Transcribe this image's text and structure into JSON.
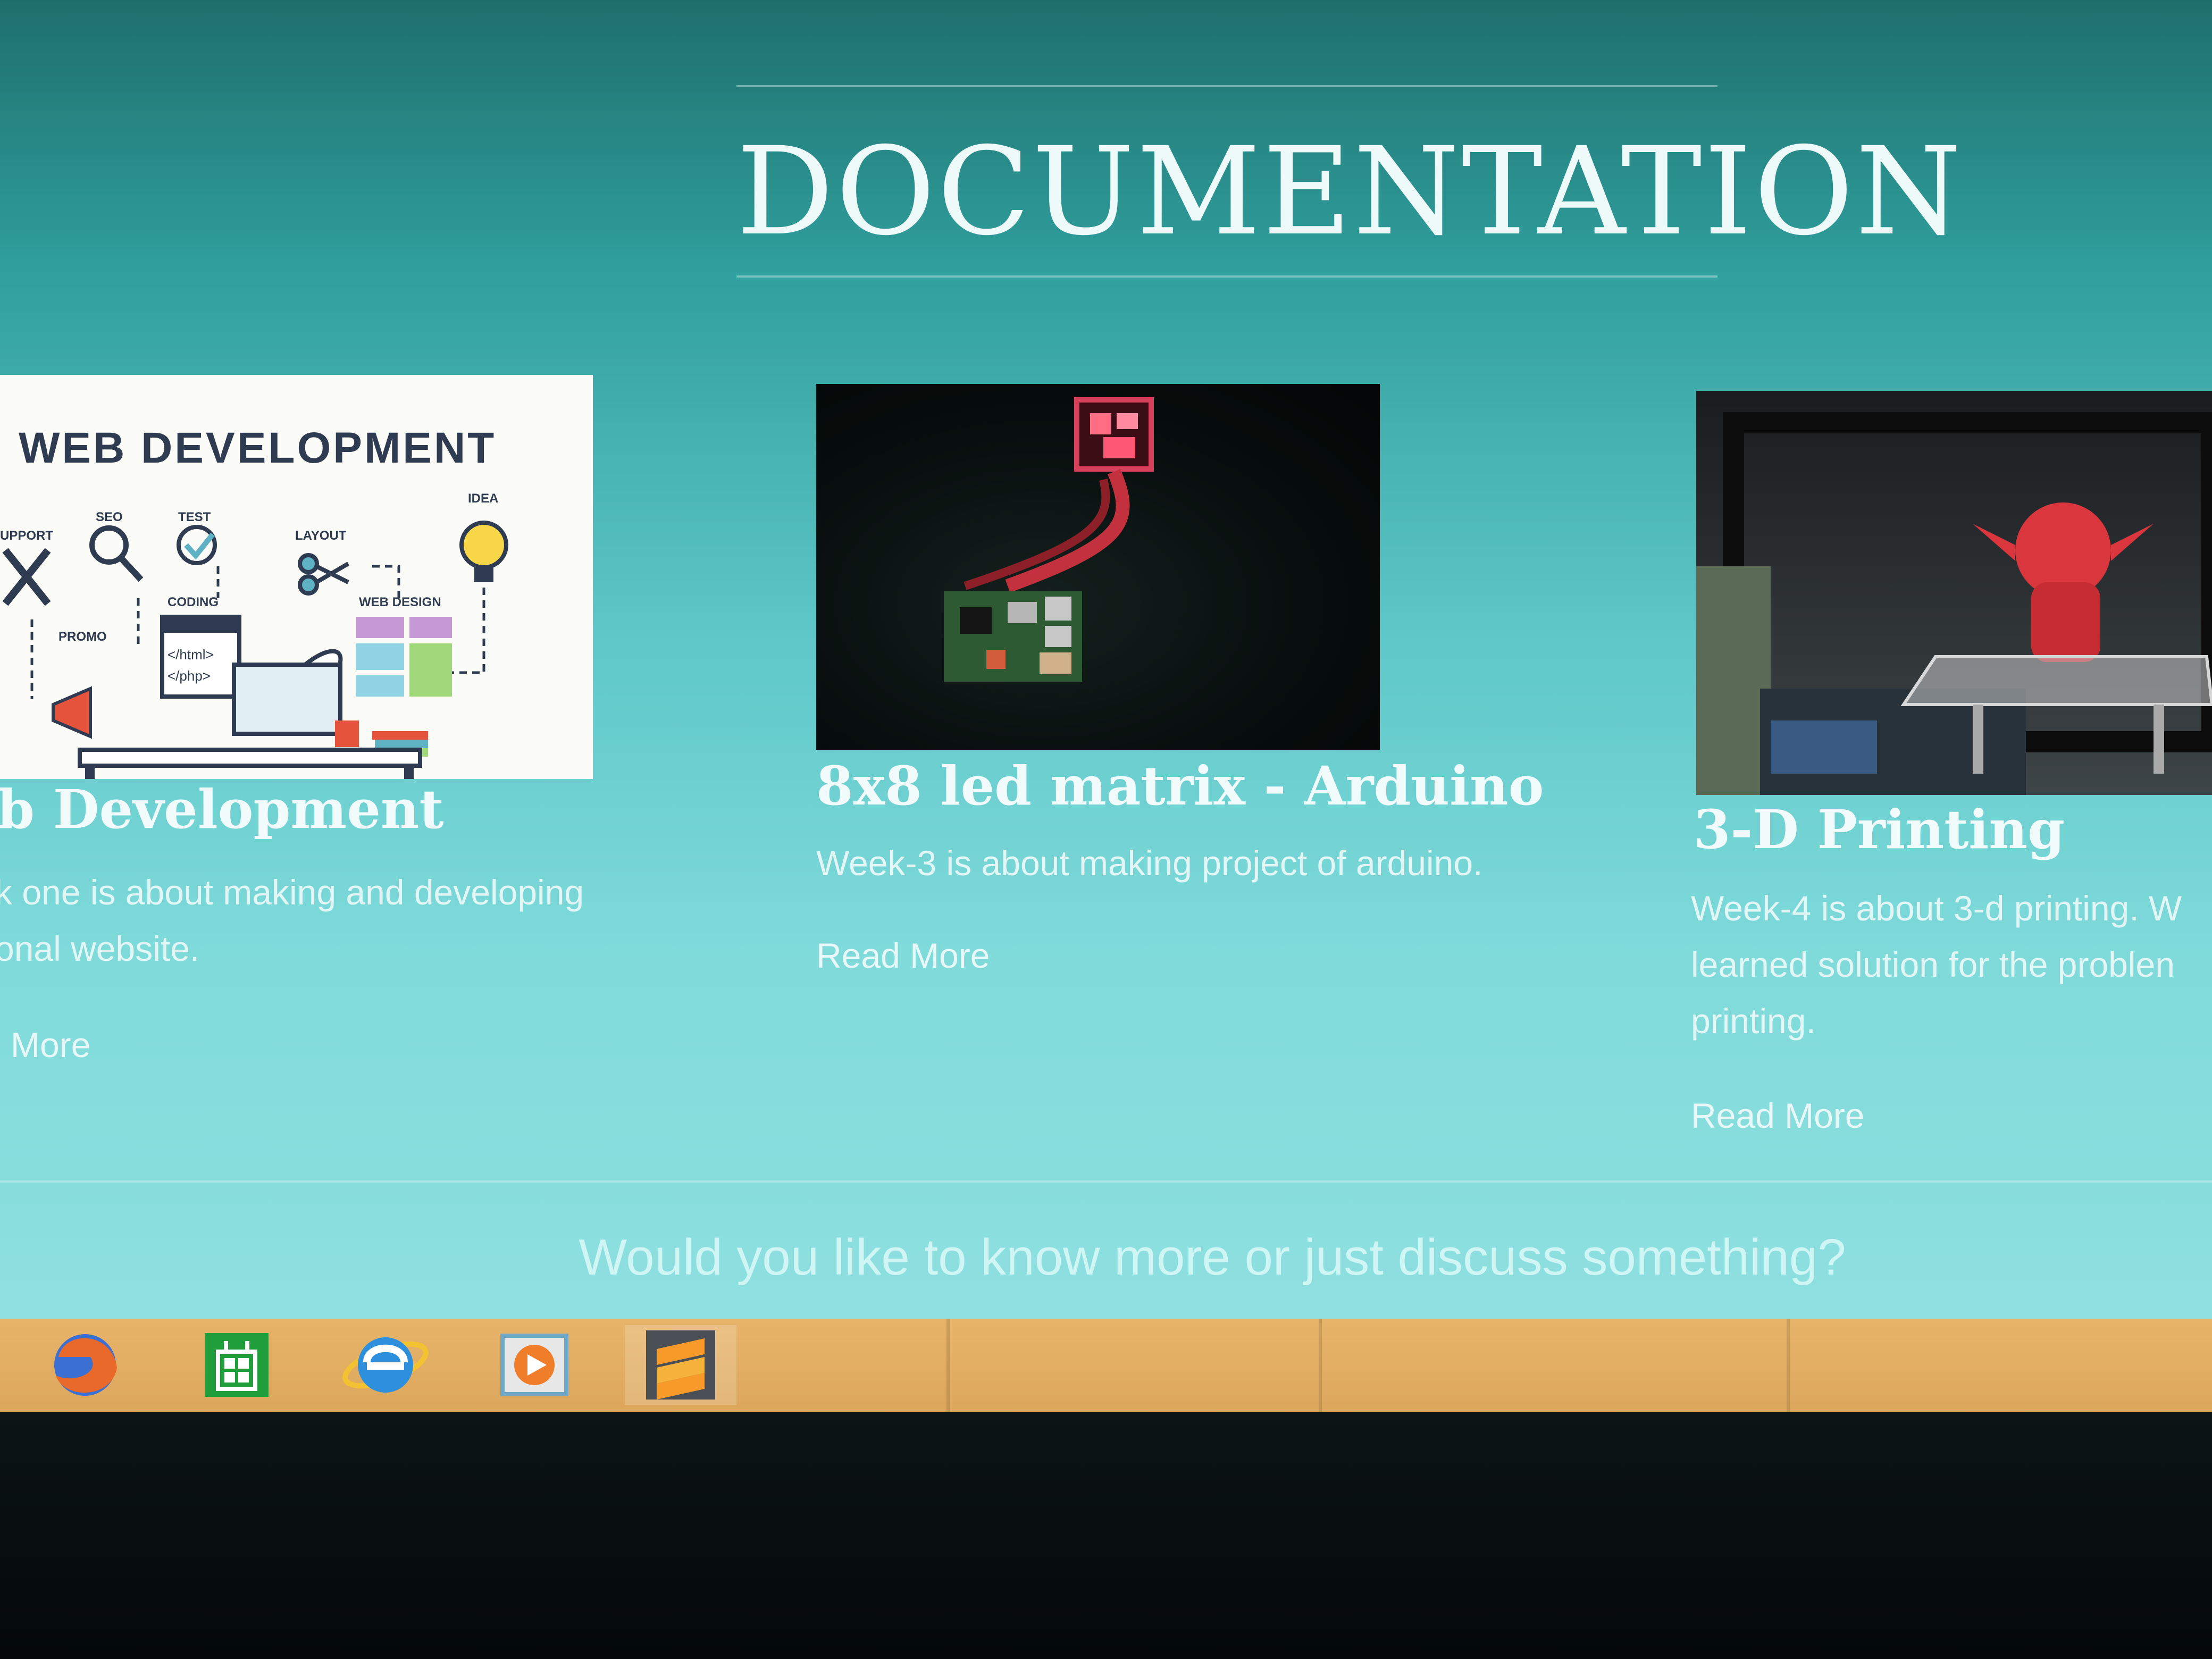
{
  "section": {
    "heading": "DOCUMENTATION"
  },
  "cards": [
    {
      "image_text": {
        "title": "WEB DEVELOPMENT",
        "support": "UPPORT",
        "seo": "SEO",
        "test": "TEST",
        "layout": "LAYOUT",
        "idea": "IDEA",
        "coding": "CODING",
        "web_design": "WEB DESIGN",
        "promo": "PROMO",
        "html": "</html>",
        "php": "</php>"
      },
      "title": "b Development",
      "desc_line1": "k one is about making and developing",
      "desc_line2": "onal website.",
      "read_more": "More"
    },
    {
      "title": "8x8 led matrix - Arduino",
      "desc_line1": "Week-3 is about making project of arduino.",
      "read_more": "Read More"
    },
    {
      "title": "3-D Printing",
      "desc_line1": "Week-4 is about 3-d printing. W",
      "desc_line2": "learned solution for the problen",
      "desc_line3": "printing.",
      "read_more": "Read More"
    }
  ],
  "contact": {
    "prompt": "Would you like to know more or just discuss something?"
  },
  "taskbar": {
    "items": [
      "firefox-icon",
      "store-icon",
      "internet-explorer-icon",
      "media-player-icon",
      "sublime-text-icon"
    ],
    "color": "#dca75c"
  },
  "colors": {
    "background_top": "#1e6f6c",
    "background_bottom": "#8ee0df",
    "text": "#eef9f9"
  }
}
